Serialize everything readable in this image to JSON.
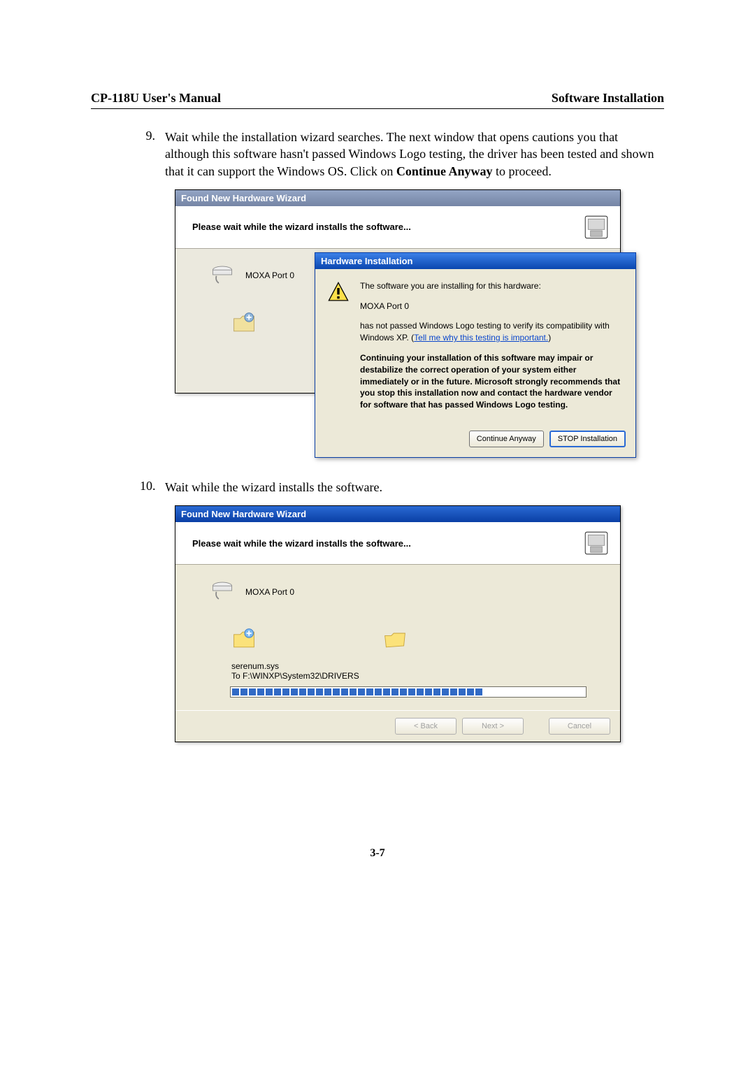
{
  "header": {
    "left": "CP-118U User's Manual",
    "right": "Software Installation"
  },
  "steps": [
    {
      "num": "9.",
      "text_1": "Wait while the installation wizard searches. The next window that opens cautions you that although this software hasn't passed Windows Logo testing, the driver has been tested and shown that it can support the Windows OS. Click on ",
      "text_bold": "Continue Anyway",
      "text_2": " to proceed."
    },
    {
      "num": "10.",
      "text_1": "Wait while the wizard installs the software.",
      "text_bold": "",
      "text_2": ""
    }
  ],
  "wizard1": {
    "titlebar": "Found New Hardware Wizard",
    "header": "Please wait while the wizard installs the software...",
    "device": "MOXA Port 0"
  },
  "popup": {
    "title": "Hardware Installation",
    "line1": "The software you are installing for this hardware:",
    "line2": "MOXA Port 0",
    "line3a": "has not passed Windows Logo testing to verify its compatibility with Windows XP. (",
    "link": "Tell me why this testing is important.",
    "line3b": ")",
    "bold": "Continuing your installation of this software may impair or destabilize the correct operation of your system either immediately or in the future. Microsoft strongly recommends that you stop this installation now and contact the hardware vendor for software that has passed Windows Logo testing.",
    "btn_continue": "Continue Anyway",
    "btn_stop": "STOP Installation"
  },
  "wizard2": {
    "titlebar": "Found New Hardware Wizard",
    "header": "Please wait while the wizard installs the software...",
    "device": "MOXA Port 0",
    "file": "serenum.sys",
    "dest": "To F:\\WINXP\\System32\\DRIVERS",
    "btn_back": "< Back",
    "btn_next": "Next >",
    "btn_cancel": "Cancel"
  },
  "page_number": "3-7"
}
